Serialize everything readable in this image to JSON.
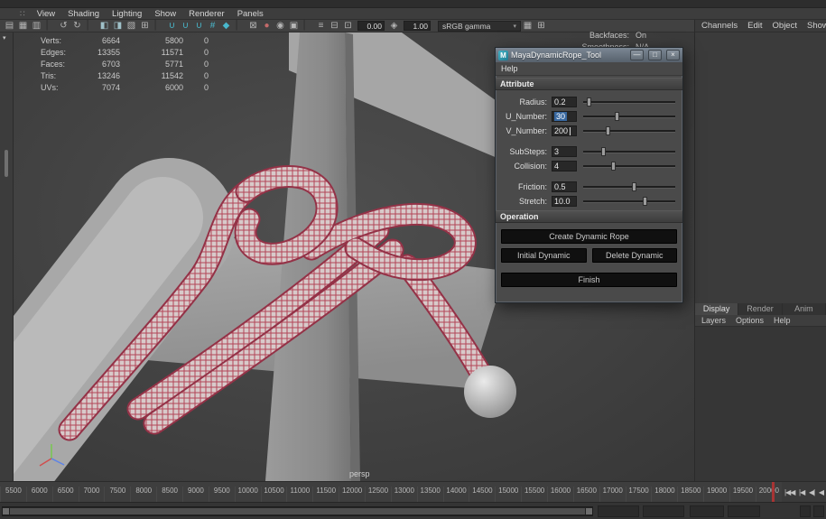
{
  "colors": {
    "accent_teal": "#49b8cc",
    "rope_red": "#b24457",
    "selection_blue": "#3868a0",
    "playhead_red": "#a83434"
  },
  "menubar": {
    "grip": "∷",
    "items": [
      "View",
      "Shading",
      "Lighting",
      "Show",
      "Renderer",
      "Panels"
    ]
  },
  "toolbar": {
    "icons": [
      {
        "g": "▤",
        "col": "#b5b5b5"
      },
      {
        "g": "▦",
        "col": "#b5b5b5"
      },
      {
        "g": "▥",
        "col": "#b5b5b5"
      },
      {
        "g": "▏",
        "col": "#2e2e2e"
      },
      {
        "g": "↺",
        "col": "#b5b5b5"
      },
      {
        "g": "↻",
        "col": "#b5b5b5"
      },
      {
        "g": "▏",
        "col": "#2e2e2e"
      },
      {
        "g": "◧",
        "col": "#9fc1c9"
      },
      {
        "g": "◨",
        "col": "#9fc1c9"
      },
      {
        "g": "▧",
        "col": "#b5b5b5"
      },
      {
        "g": "⊞",
        "col": "#b5b5b5"
      },
      {
        "g": "▏",
        "col": "#2e2e2e"
      },
      {
        "g": "∪",
        "col": "#49b8cc"
      },
      {
        "g": "∪",
        "col": "#49b8cc"
      },
      {
        "g": "∪",
        "col": "#49b8cc"
      },
      {
        "g": "#",
        "col": "#49b8cc"
      },
      {
        "g": "◆",
        "col": "#49b8cc"
      },
      {
        "g": "▏",
        "col": "#2e2e2e"
      },
      {
        "g": "⊠",
        "col": "#b5b5b5"
      },
      {
        "g": "●",
        "col": "#c46a6a"
      },
      {
        "g": "◉",
        "col": "#b5b5b5"
      },
      {
        "g": "▣",
        "col": "#b5b5b5"
      },
      {
        "g": "▏",
        "col": "#2e2e2e"
      },
      {
        "g": "≡",
        "col": "#b5b5b5"
      },
      {
        "g": "⊟",
        "col": "#b5b5b5"
      },
      {
        "g": "⊡",
        "col": "#b5b5b5"
      }
    ],
    "icon_mid": "◈",
    "field1": "0.00",
    "field2": "1.00",
    "gamma_label": "sRGB gamma",
    "caret": "▾",
    "icons2": [
      {
        "g": "▦",
        "col": "#b5b5b5"
      },
      {
        "g": "⊞",
        "col": "#b5b5b5"
      }
    ]
  },
  "hud": {
    "rows": [
      {
        "label": "Verts:",
        "a": "6664",
        "b": "5800",
        "c": "0"
      },
      {
        "label": "Edges:",
        "a": "13355",
        "b": "11571",
        "c": "0"
      },
      {
        "label": "Faces:",
        "a": "6703",
        "b": "5771",
        "c": "0"
      },
      {
        "label": "Tris:",
        "a": "13246",
        "b": "11542",
        "c": "0"
      },
      {
        "label": "UVs:",
        "a": "7074",
        "b": "6000",
        "c": "0"
      }
    ]
  },
  "viewport": {
    "camera": "persp",
    "overlay": [
      {
        "label": "Backfaces:",
        "value": "On"
      },
      {
        "label": "Smoothness:",
        "value": "N/A"
      }
    ]
  },
  "dialog": {
    "title": "MayaDynamicRope_Tool",
    "icon_letter": "M",
    "window_buttons": {
      "minimize": "—",
      "maximize": "□",
      "close": "×"
    },
    "menu_label": "Help",
    "attribute_header": "Attribute",
    "operation_header": "Operation",
    "fields": [
      {
        "label": "Radius:",
        "value": "0.2",
        "pct": "4%"
      },
      {
        "label": "U_Number:",
        "value": "30",
        "pct": "34%",
        "selected": true
      },
      {
        "label": "V_Number:",
        "value": "200",
        "pct": "24%",
        "cursor": true
      },
      {
        "label": "SubSteps:",
        "value": "3",
        "pct": "19%",
        "gap": true
      },
      {
        "label": "Collision:",
        "value": "4",
        "pct": "30%"
      },
      {
        "label": "Friction:",
        "value": "0.5",
        "pct": "52%",
        "gap": true
      },
      {
        "label": "Stretch:",
        "value": "10.0",
        "pct": "63%"
      }
    ],
    "buttons": {
      "create": "Create Dynamic Rope",
      "initial": "Initial Dynamic",
      "delete": "Delete  Dynamic",
      "finish": "Finish"
    }
  },
  "right_panel": {
    "menu": [
      "Channels",
      "Edit",
      "Object",
      "Show"
    ],
    "tabs": [
      {
        "label": "Display",
        "active": true
      },
      {
        "label": "Render"
      },
      {
        "label": "Anim"
      }
    ],
    "submenu": [
      "Layers",
      "Options",
      "Help"
    ],
    "audio_glyph": "◄)"
  },
  "timeline": {
    "ticks": [
      "5500",
      "6000",
      "6500",
      "7000",
      "7500",
      "8000",
      "8500",
      "9000",
      "9500",
      "10000",
      "10500",
      "11000",
      "11500",
      "12000",
      "12500",
      "13000",
      "13500",
      "14000",
      "14500",
      "15000",
      "15500",
      "16000",
      "16500",
      "17000",
      "17500",
      "18000",
      "18500",
      "19000",
      "19500",
      "20000"
    ]
  },
  "playback": {
    "buttons": [
      "|◀◀",
      "|◀",
      "◀|",
      "◀"
    ]
  }
}
